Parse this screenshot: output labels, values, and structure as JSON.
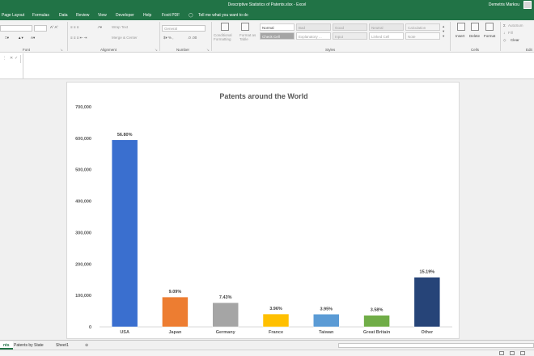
{
  "window": {
    "title": "Descriptive Statistics of Patents.xlsx - Excel",
    "user": "Demetris Markou"
  },
  "tabs": [
    "Page Layout",
    "Formulas",
    "Data",
    "Review",
    "View",
    "Developer",
    "Help",
    "Foxit PDF"
  ],
  "tell_me": "Tell me what you want to do",
  "ribbon": {
    "font_group": "Font",
    "alignment_group": "Alignment",
    "wrap_text": "Wrap Text",
    "merge_center": "Merge & Center",
    "number_group": "Number",
    "number_format": "General",
    "conditional_formatting": "Conditional Formatting",
    "format_as_table": "Format as Table",
    "styles_group": "Styles",
    "styles": [
      "Normal",
      "Bad",
      "Good",
      "Neutral",
      "Calculation",
      "Check Cell",
      "Explanatory ...",
      "Input",
      "Linked Cell",
      "Note"
    ],
    "cells_group": "Cells",
    "insert": "Insert",
    "delete": "Delete",
    "format": "Format",
    "autosum": "AutoSum",
    "fill": "Fill",
    "clear": "Clear",
    "editing_group": "Edit"
  },
  "sheet_tabs": [
    "nts",
    "Patents by State",
    "Sheet1"
  ],
  "chart_data": {
    "type": "bar",
    "title": "Patents around the World",
    "categories": [
      "USA",
      "Japan",
      "Germany",
      "France",
      "Taiwan",
      "Great Britain",
      "Other"
    ],
    "values": [
      595000,
      95000,
      77000,
      41000,
      40500,
      37000,
      158000
    ],
    "data_labels": [
      "56.80%",
      "9.09%",
      "7.43%",
      "3.96%",
      "3.95%",
      "3.58%",
      "15.19%"
    ],
    "ylim": [
      0,
      700000
    ],
    "yticks": [
      "0",
      "100,000",
      "200,000",
      "300,000",
      "400,000",
      "500,000",
      "600,000",
      "700,000"
    ],
    "colors": [
      "#3a6fcf",
      "#ed7d31",
      "#a5a5a5",
      "#ffc000",
      "#5b9bd5",
      "#70ad47",
      "#264478"
    ],
    "grid": false,
    "legend": "none"
  }
}
